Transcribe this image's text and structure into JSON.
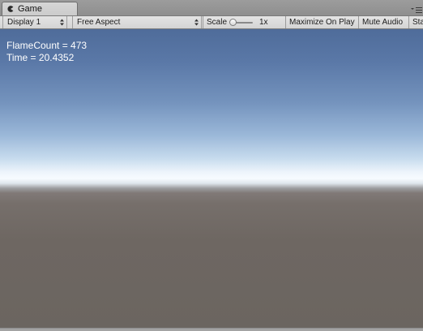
{
  "tab": {
    "title": "Game",
    "icon": "pacman-icon"
  },
  "toolbar": {
    "display": "Display 1",
    "aspect": "Free Aspect",
    "scale_label": "Scale",
    "scale_value": "1x",
    "scale_slider_value": 0,
    "maximize_on_play": "Maximize On Play",
    "mute_audio": "Mute Audio",
    "stats": "Sta"
  },
  "game_view": {
    "lines": [
      "FlameCount = 473",
      "Time = 20.4352"
    ],
    "colors": {
      "sky_top": "#4f6c9a",
      "horizon": "#f7fbff",
      "ground": "#6b6560"
    }
  }
}
